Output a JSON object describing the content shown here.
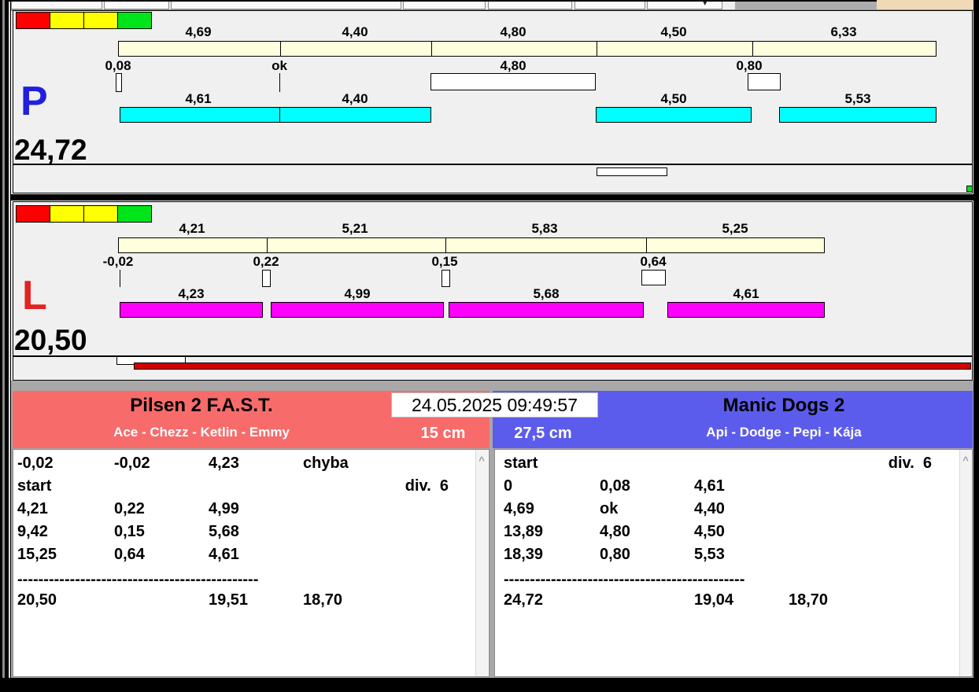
{
  "toolbar": {
    "dropdown_icon": "▾"
  },
  "colors": {
    "light_red": "#FF0000",
    "light_yellow": "#FFFF00",
    "light_green": "#00E41C",
    "lane_p_letter": "#2020DD",
    "lane_l_letter": "#E32222",
    "bar_cyan": "#00FFFF",
    "bar_magenta": "#FF00FF",
    "cream_bar": "#FFFFDE",
    "header_left": "#F76B6B",
    "header_right": "#5C5CEC",
    "progress_red": "#D40000",
    "green_indicator": "#00E41C"
  },
  "lane_p": {
    "label": "P",
    "total": "24,72",
    "lights": [
      "#FF0000",
      "#FFFF00",
      "#FFFF00",
      "#00E41C"
    ],
    "top_splits": [
      "4,69",
      "4,40",
      "4,80",
      "4,50",
      "6,33"
    ],
    "mid_values": [
      "0,08",
      "ok",
      "4,80",
      "0,80"
    ],
    "bottom_splits": [
      "4,61",
      "4,40",
      "4,50",
      "5,53"
    ]
  },
  "lane_l": {
    "label": "L",
    "total": "20,50",
    "lights": [
      "#FF0000",
      "#FFFF00",
      "#FFFF00",
      "#00E41C"
    ],
    "top_splits": [
      "4,21",
      "5,21",
      "5,83",
      "5,25"
    ],
    "mid_values": [
      "-0,02",
      "0,22",
      "0,15",
      "0,64"
    ],
    "bottom_splits": [
      "4,23",
      "4,99",
      "5,68",
      "4,61"
    ]
  },
  "scoreboard": {
    "timestamp": "24.05.2025 09:49:57",
    "scroll_up_icon": "^",
    "left": {
      "team": "Pilsen 2 F.A.S.T.",
      "dogs": "Ace - Chezz - Ketlin - Emmy",
      "jump_height": "15 cm",
      "division": "div.  6",
      "division_row": 1,
      "rows": [
        [
          "-0,02",
          "-0,02",
          "4,23",
          "chyba"
        ],
        [
          "start",
          "",
          "",
          ""
        ],
        [
          "4,21",
          "0,22",
          "4,99",
          ""
        ],
        [
          "9,42",
          "0,15",
          "5,68",
          ""
        ],
        [
          "15,25",
          "0,64",
          "4,61",
          ""
        ]
      ],
      "divider": "----------------------------------------------",
      "totals": [
        "20,50",
        "19,51",
        "18,70"
      ]
    },
    "right": {
      "team": "Manic Dogs 2",
      "dogs": "Api - Dodge - Pepi - Kája",
      "jump_height": "27,5 cm",
      "division": "div.  6",
      "division_row": 0,
      "rows": [
        [
          "start",
          "",
          "",
          ""
        ],
        [
          "0",
          "0,08",
          "4,61",
          ""
        ],
        [
          "4,69",
          "ok",
          "4,40",
          ""
        ],
        [
          "13,89",
          "4,80",
          "4,50",
          ""
        ],
        [
          "18,39",
          "0,80",
          "5,53",
          ""
        ]
      ],
      "divider": "----------------------------------------------",
      "totals": [
        "24,72",
        "19,04",
        "18,70"
      ]
    }
  }
}
